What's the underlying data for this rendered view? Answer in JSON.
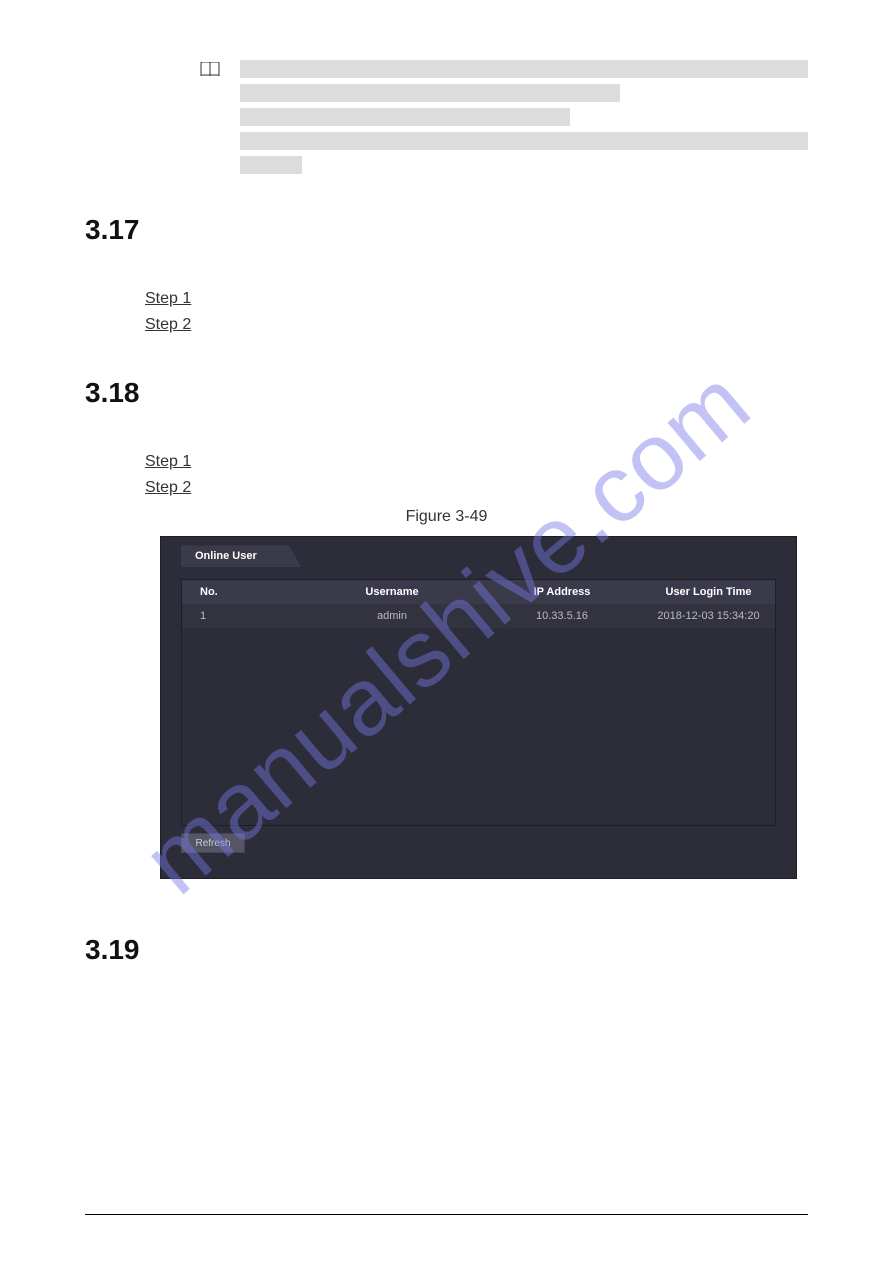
{
  "watermark": "manualshive.com",
  "sections": {
    "s317": {
      "number": "3.17",
      "steps": [
        "Step 1",
        "Step 2"
      ]
    },
    "s318": {
      "number": "3.18",
      "steps": [
        "Step 1",
        "Step 2"
      ],
      "figure_caption": "Figure 3-49"
    },
    "s319": {
      "number": "3.19"
    }
  },
  "screenshot": {
    "tab_label": "Online User",
    "columns": {
      "no": "No.",
      "username": "Username",
      "ip": "IP Address",
      "login_time": "User Login Time"
    },
    "rows": [
      {
        "no": "1",
        "username": "admin",
        "ip": "10.33.5.16",
        "login_time": "2018-12-03 15:34:20"
      }
    ],
    "refresh_label": "Refresh"
  }
}
